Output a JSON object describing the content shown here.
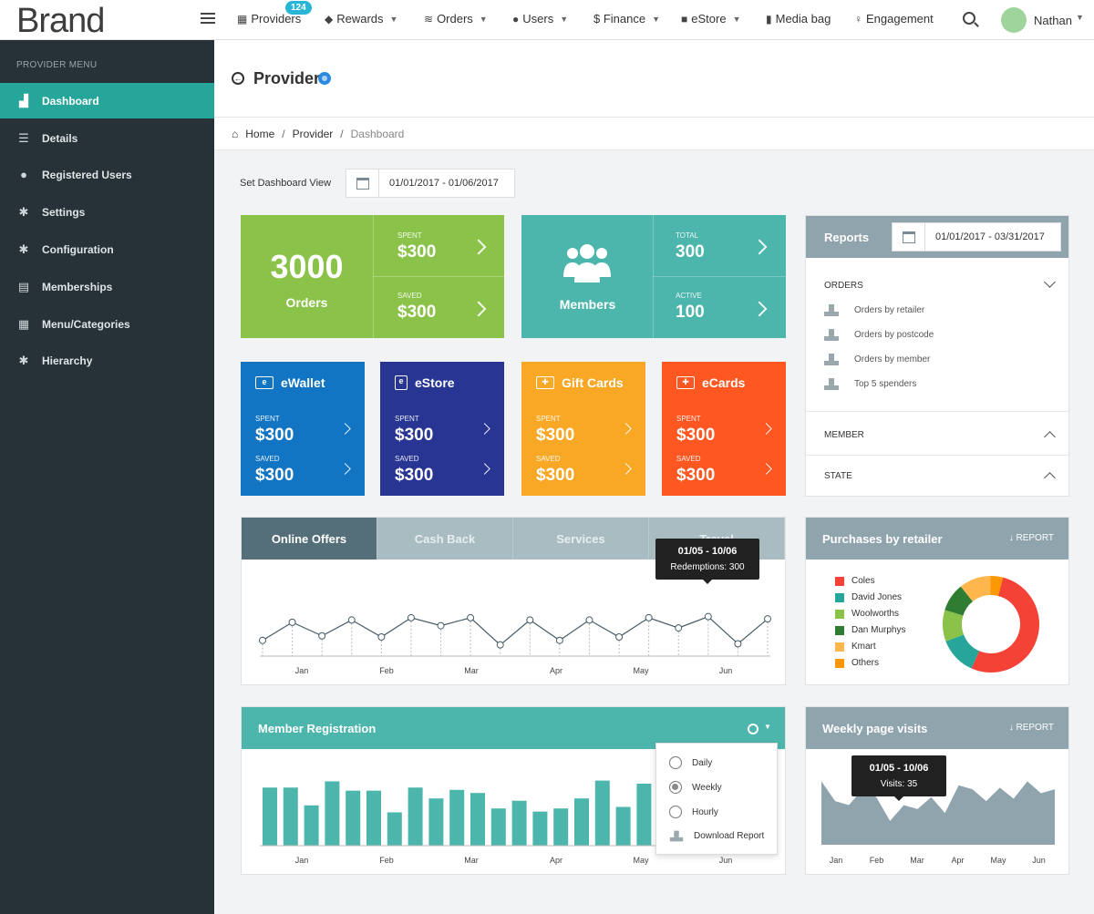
{
  "topbar": {
    "brand": "Brand",
    "nav": [
      {
        "label": "Providers",
        "icon": "building-icon"
      },
      {
        "label": "Rewards",
        "icon": "tag-icon"
      },
      {
        "label": "Orders",
        "icon": "layers-icon"
      },
      {
        "label": "Users",
        "icon": "users-icon"
      },
      {
        "label": "$ Finance",
        "icon": "dollar-icon"
      },
      {
        "label": "eStore",
        "icon": "bag-icon"
      },
      {
        "label": "Media bag",
        "icon": "file-icon"
      },
      {
        "label": "Engagement",
        "icon": "bulb-icon"
      }
    ],
    "providers_badge": "124",
    "user": "Nathan"
  },
  "sidebar": {
    "heading": "PROVIDER MENU",
    "items": [
      {
        "label": "Dashboard",
        "icon": "chart-icon"
      },
      {
        "label": "Details",
        "icon": "list-icon"
      },
      {
        "label": "Registered Users",
        "icon": "user-icon"
      },
      {
        "label": "Settings",
        "icon": "gear-icon"
      },
      {
        "label": "Configuration",
        "icon": "gear-icon"
      },
      {
        "label": "Memberships",
        "icon": "card-icon"
      },
      {
        "label": "Menu/Categories",
        "icon": "grid-icon"
      },
      {
        "label": "Hierarchy",
        "icon": "gear-icon"
      }
    ]
  },
  "page": {
    "title": "Provider",
    "breadcrumb": [
      "Home",
      "Provider",
      "Dashboard"
    ],
    "dashboard_view_label": "Set Dashboard View",
    "dashboard_date_range": "01/01/2017 - 01/06/2017"
  },
  "tiles": {
    "orders": {
      "count": "3000",
      "label": "Orders",
      "spent_label": "SPENT",
      "spent": "$300",
      "saved_label": "SAVED",
      "saved": "$300",
      "color": "#8bc34a"
    },
    "members": {
      "label": "Members",
      "total_label": "TOTAL",
      "total": "300",
      "active_label": "ACTIVE",
      "active": "100",
      "color": "#4db6ac"
    },
    "cards": [
      {
        "title": "eWallet",
        "spent_label": "SPENT",
        "spent": "$300",
        "saved_label": "SAVED",
        "saved": "$300",
        "color": "#1275c4"
      },
      {
        "title": "eStore",
        "spent_label": "SPENT",
        "spent": "$300",
        "saved_label": "SAVED",
        "saved": "$300",
        "color": "#283593"
      },
      {
        "title": "Gift Cards",
        "spent_label": "SPENT",
        "spent": "$300",
        "saved_label": "SAVED",
        "saved": "$300",
        "color": "#f9a825"
      },
      {
        "title": "eCards",
        "spent_label": "SPENT",
        "spent": "$300",
        "saved_label": "SAVED",
        "saved": "$300",
        "color": "#ff5722"
      }
    ]
  },
  "reports": {
    "title": "Reports",
    "date_range": "01/01/2017 - 03/31/2017",
    "orders_heading": "ORDERS",
    "orders_items": [
      "Orders by retailer",
      "Orders by postcode",
      "Orders by member",
      "Top 5 spenders"
    ],
    "member_heading": "MEMBER",
    "state_heading": "STATE"
  },
  "offers": {
    "tabs": [
      "Online Offers",
      "Cash Back",
      "Services",
      "Travel"
    ],
    "tooltip_title": "01/05 - 10/06",
    "tooltip_text": "Redemptions: 300",
    "months": [
      "Jan",
      "Feb",
      "Mar",
      "Apr",
      "May",
      "Jun"
    ]
  },
  "purchases": {
    "title": "Purchases by retailer",
    "report_label": "REPORT"
  },
  "member_registration": {
    "title": "Member Registration",
    "options": [
      "Daily",
      "Weekly",
      "Hourly",
      "Download Report"
    ],
    "selected": "Weekly",
    "months": [
      "Jan",
      "Feb",
      "Mar",
      "Apr",
      "May",
      "Jun"
    ]
  },
  "weekly": {
    "title": "Weekly page visits",
    "report_label": "REPORT",
    "tooltip_title": "01/05 - 10/06",
    "tooltip_text": "Visits: 35",
    "months": [
      "Jan",
      "Feb",
      "Mar",
      "Apr",
      "May",
      "Jun"
    ]
  },
  "chart_data": [
    {
      "type": "line",
      "x": [
        "1",
        "2",
        "3",
        "4",
        "5",
        "6",
        "7",
        "8",
        "9",
        "10",
        "11",
        "12",
        "13",
        "14",
        "15",
        "16",
        "17",
        "18"
      ],
      "values": [
        22,
        38,
        26,
        40,
        25,
        42,
        35,
        42,
        18,
        40,
        22,
        40,
        25,
        42,
        33,
        43,
        19,
        41
      ],
      "xticks": [
        "Jan",
        "Feb",
        "Mar",
        "Apr",
        "May",
        "Jun"
      ]
    },
    {
      "type": "pie",
      "categories": [
        "Coles",
        "David Jones",
        "Woolworths",
        "Dan Murphys",
        "Kmart",
        "Others"
      ],
      "values": [
        50,
        12,
        10,
        9,
        10,
        4
      ],
      "colors": [
        "#f44336",
        "#26a69a",
        "#8bc34a",
        "#2e7d32",
        "#ffb74d",
        "#ff9800"
      ]
    },
    {
      "type": "bar",
      "values": [
        75,
        75,
        52,
        83,
        71,
        71,
        43,
        75,
        61,
        72,
        68,
        48,
        58,
        44,
        48,
        61,
        84,
        50,
        80,
        68,
        72,
        60,
        70,
        55,
        65,
        50,
        45,
        55
      ],
      "xticks": [
        "Jan",
        "Feb",
        "Mar",
        "Apr",
        "May",
        "Jun"
      ],
      "color": "#4db6ac"
    },
    {
      "type": "area",
      "values": [
        80,
        55,
        50,
        70,
        60,
        30,
        50,
        45,
        60,
        40,
        75,
        70,
        55,
        72,
        58,
        80,
        65,
        70
      ],
      "xticks": [
        "Jan",
        "Feb",
        "Mar",
        "Apr",
        "May",
        "Jun"
      ],
      "color": "#90a4ae"
    }
  ]
}
